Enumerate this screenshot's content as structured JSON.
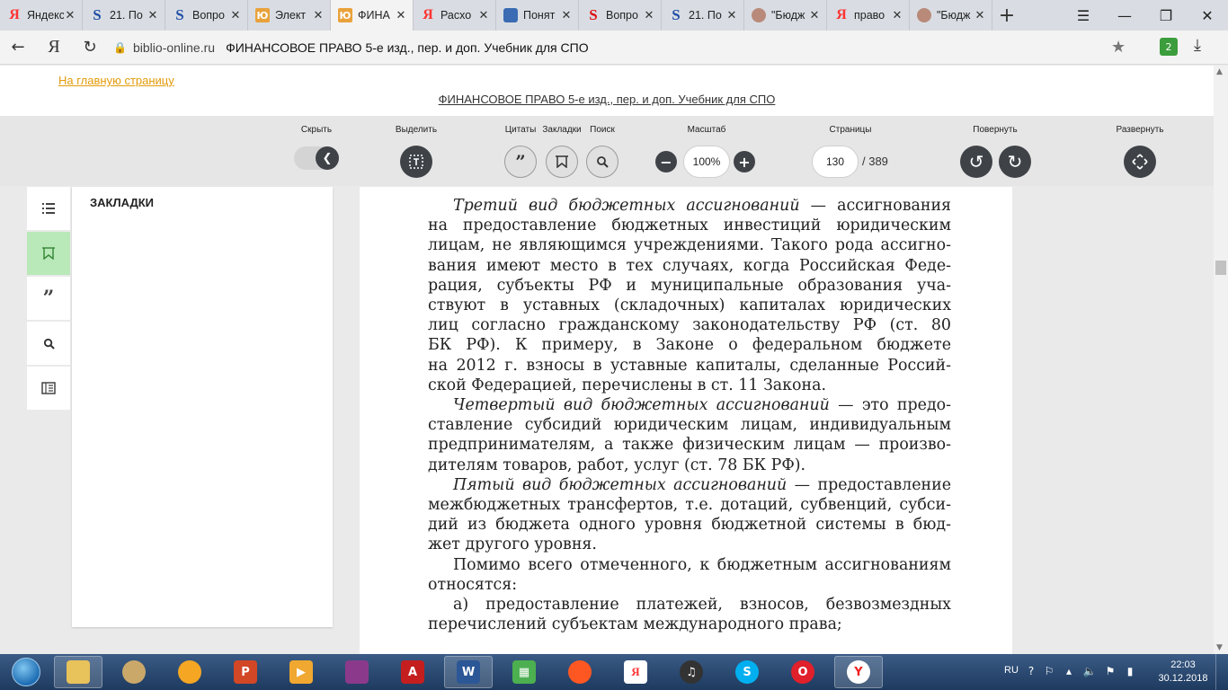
{
  "tabs": [
    {
      "title": "Яндекс",
      "fav": "Я",
      "type": "ya"
    },
    {
      "title": "21. По",
      "fav": "S",
      "type": "s"
    },
    {
      "title": "Вопро",
      "fav": "S",
      "type": "s"
    },
    {
      "title": "Элект",
      "fav": "Ю",
      "type": "yu"
    },
    {
      "title": "ФИНА",
      "fav": "Ю",
      "type": "yu",
      "active": true
    },
    {
      "title": "Расхо",
      "fav": "Я",
      "type": "ya"
    },
    {
      "title": "Понят",
      "fav": "",
      "type": "pon"
    },
    {
      "title": "Вопро",
      "fav": "S",
      "type": "sred"
    },
    {
      "title": "21. По",
      "fav": "S",
      "type": "s"
    },
    {
      "title": "\"Бюдж",
      "fav": "",
      "type": "bud"
    },
    {
      "title": "право",
      "fav": "Я",
      "type": "ya"
    },
    {
      "title": "\"Бюдж",
      "fav": "",
      "type": "bud"
    }
  ],
  "address": {
    "domain": "biblio-online.ru",
    "title": "ФИНАНСОВОЕ ПРАВО 5-е изд., пер. и доп. Учебник для СПО"
  },
  "header": {
    "home_link": "На главную страницу",
    "book_title": "ФИНАНСОВОЕ ПРАВО 5-е изд., пер. и доп. Учебник для СПО"
  },
  "toolbar": {
    "hide": "Скрыть",
    "select": "Выделить",
    "quotes": "Цитаты",
    "bookmarks": "Закладки",
    "search": "Поиск",
    "scale": "Масштаб",
    "zoom_value": "100%",
    "pages": "Страницы",
    "current_page": "130",
    "total_pages": "/ 389",
    "rotate": "Повернуть",
    "expand": "Развернуть"
  },
  "panel": {
    "title": "ЗАКЛАДКИ"
  },
  "doc": {
    "p1_italic": "Третий вид бюджетных ассигнований",
    "p1_rest_lines": [
      " — ассигнования",
      "на предоставление бюджетных инвестиций юридическим",
      "лицам, не являющимся учреждениями. Такого рода ассигно-",
      "вания имеют место в тех случаях, когда Российская Феде-",
      "рация, субъекты РФ и муниципальные образования уча-",
      "ствуют в уставных (складочных) капиталах юридических",
      "лиц согласно гражданскому законодательству РФ (ст. 80",
      "БК РФ). К примеру, в Законе о федеральном бюджете",
      "на 2012 г. взносы в уставные капиталы, сделанные Россий-",
      "ской Федерацией, перечислены в ст. 11 Закона."
    ],
    "p2_italic": "Четвертый вид бюджетных ассигнований",
    "p2_rest_lines": [
      " — это предо-",
      "ставление субсидий юридическим лицам, индивидуальным",
      "предпринимателям, а также физическим лицам — произво-",
      "дителям товаров, работ, услуг (ст. 78 БК РФ)."
    ],
    "p3_italic": "Пятый вид бюджетных ассигнований",
    "p3_rest_lines": [
      " — предоставление",
      "межбюджетных трансфертов, т.е. дотаций, субвенций, субси-",
      "дий из бюджета одного уровня бюджетной системы в бюд-",
      "жет другого уровня."
    ],
    "p4_lines": [
      "Помимо всего отмеченного, к бюджетным ассигнованиям",
      "относятся:"
    ],
    "p5_lines": [
      "а) предоставление платежей, взносов, безвозмездных",
      "перечислений субъектам международного права;"
    ]
  },
  "taskbar": {
    "lang": "RU",
    "time": "22:03",
    "date": "30.12.2018"
  }
}
